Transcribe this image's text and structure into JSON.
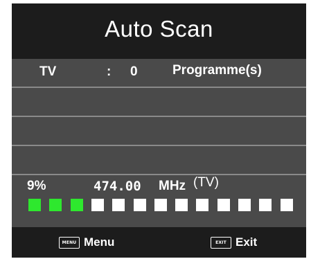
{
  "title": "Auto Scan",
  "status": {
    "tv_label": "TV",
    "colon": ":",
    "count": "0",
    "count_unit": "Programme(s)"
  },
  "progress": {
    "percent_text": "9%",
    "frequency": "474.00",
    "frequency_unit": "MHz",
    "band": "(TV)",
    "total_blocks": 13,
    "filled_blocks": 3,
    "filled_color": "#2ee82e",
    "empty_color": "#ffffff"
  },
  "footer": {
    "menu_key": "MENU",
    "menu_label": "Menu",
    "exit_key": "EXIT",
    "exit_label": "Exit"
  }
}
